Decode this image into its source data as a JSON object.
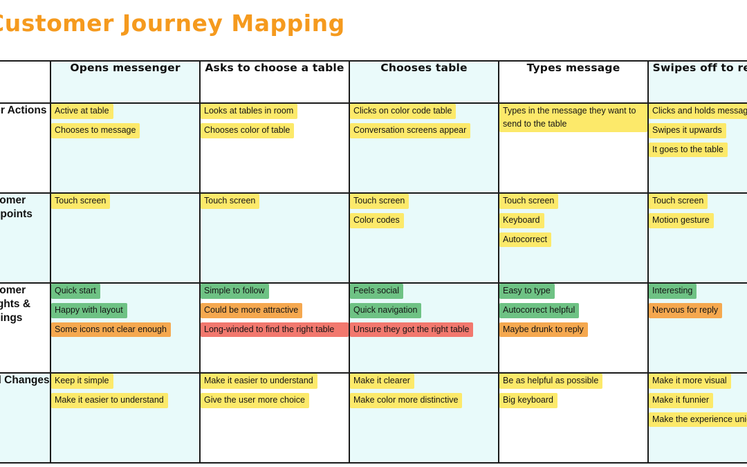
{
  "board": {
    "title": "Customer Journey Mapping",
    "title_accent_color": "#f59a1e"
  },
  "table": {
    "corner_label": "",
    "stages": [
      "Opens messenger",
      "Asks to choose a table",
      "Chooses table",
      "Types message",
      "Swipes off to recipient"
    ],
    "rows": [
      {
        "label": "Customer Actions",
        "cells": [
          {
            "notes": [
              {
                "text": "Active at table",
                "color": "yellow"
              },
              {
                "text": "Chooses to message",
                "color": "yellow"
              }
            ]
          },
          {
            "notes": [
              {
                "text": "Looks at tables in room",
                "color": "yellow"
              },
              {
                "text": "Chooses color of table",
                "color": "yellow"
              }
            ]
          },
          {
            "notes": [
              {
                "text": "Clicks on color code table",
                "color": "yellow"
              },
              {
                "text": "Conversation screens appear",
                "color": "yellow"
              }
            ]
          },
          {
            "notes": [
              {
                "text": "Types in the message they want to send to the table",
                "color": "yellow",
                "wide": true
              }
            ]
          },
          {
            "notes": [
              {
                "text": "Clicks and holds message icon",
                "color": "yellow"
              },
              {
                "text": "Swipes it upwards",
                "color": "yellow"
              },
              {
                "text": "It goes to the table",
                "color": "yellow"
              }
            ]
          }
        ]
      },
      {
        "label": "Customer Touchpoints",
        "cells": [
          {
            "notes": [
              {
                "text": "Touch screen",
                "color": "yellow"
              }
            ]
          },
          {
            "notes": [
              {
                "text": "Touch screen",
                "color": "yellow"
              }
            ]
          },
          {
            "notes": [
              {
                "text": "Touch screen",
                "color": "yellow"
              },
              {
                "text": "Color codes",
                "color": "yellow"
              }
            ]
          },
          {
            "notes": [
              {
                "text": "Touch screen",
                "color": "yellow"
              },
              {
                "text": "Keyboard",
                "color": "yellow"
              },
              {
                "text": "Autocorrect",
                "color": "yellow"
              }
            ]
          },
          {
            "notes": [
              {
                "text": "Touch screen",
                "color": "yellow"
              },
              {
                "text": "Motion gesture",
                "color": "yellow"
              }
            ]
          }
        ]
      },
      {
        "label": "Customer Thoughts & Feelings",
        "cells": [
          {
            "notes": [
              {
                "text": "Quick start",
                "color": "green"
              },
              {
                "text": "Happy with layout",
                "color": "green"
              },
              {
                "text": "Some icons not clear enough",
                "color": "orange"
              }
            ]
          },
          {
            "notes": [
              {
                "text": "Simple to follow",
                "color": "green"
              },
              {
                "text": "Could be more attractive",
                "color": "orange"
              },
              {
                "text": "Long-winded to find the right table",
                "color": "red",
                "wide": true
              }
            ]
          },
          {
            "notes": [
              {
                "text": "Feels social",
                "color": "green"
              },
              {
                "text": "Quick navigation",
                "color": "green"
              },
              {
                "text": "Unsure they got the right table",
                "color": "red"
              }
            ]
          },
          {
            "notes": [
              {
                "text": "Easy to type",
                "color": "green"
              },
              {
                "text": "Autocorrect helpful",
                "color": "green"
              },
              {
                "text": "Maybe drunk to reply",
                "color": "orange"
              }
            ]
          },
          {
            "notes": [
              {
                "text": "Interesting",
                "color": "green"
              },
              {
                "text": "Nervous for reply",
                "color": "orange"
              }
            ]
          }
        ]
      },
      {
        "label": "Proposed Changes",
        "cells": [
          {
            "notes": [
              {
                "text": "Keep it simple",
                "color": "yellow"
              },
              {
                "text": "Make it easier to understand",
                "color": "yellow"
              }
            ]
          },
          {
            "notes": [
              {
                "text": "Make it easier to understand",
                "color": "yellow"
              },
              {
                "text": "Give the user more choice",
                "color": "yellow"
              }
            ]
          },
          {
            "notes": [
              {
                "text": "Make it clearer",
                "color": "yellow"
              },
              {
                "text": "Make color more distinctive",
                "color": "yellow"
              }
            ]
          },
          {
            "notes": [
              {
                "text": "Be as helpful as possible",
                "color": "yellow"
              },
              {
                "text": "Big keyboard",
                "color": "yellow"
              }
            ]
          },
          {
            "notes": [
              {
                "text": "Make it more visual",
                "color": "yellow"
              },
              {
                "text": "Make it funnier",
                "color": "yellow"
              },
              {
                "text": "Make the experience unique",
                "color": "yellow"
              }
            ]
          }
        ]
      }
    ]
  },
  "colors": {
    "note_yellow": "#fce96a",
    "note_green": "#6ec284",
    "note_orange": "#f5a84f",
    "note_red": "#f2786e",
    "cell_tint": "#e8fafa",
    "grid_line": "#1a1a1a"
  }
}
